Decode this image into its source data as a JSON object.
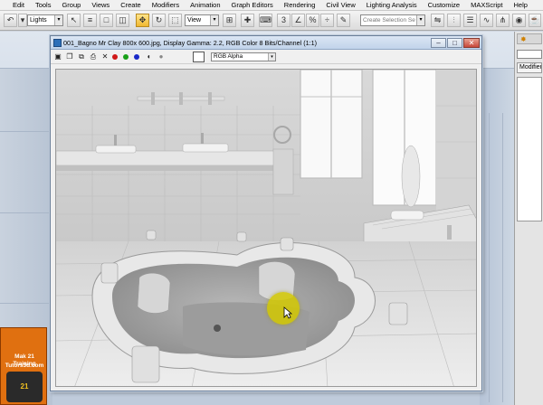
{
  "menu": [
    "Edit",
    "Tools",
    "Group",
    "Views",
    "Create",
    "Modifiers",
    "Animation",
    "Graph Editors",
    "Rendering",
    "Civil View",
    "Lighting Analysis",
    "Customize",
    "MAXScript",
    "Help"
  ],
  "toolbar": {
    "filter_value": "Lights",
    "refcoord_value": "View",
    "selection_set_placeholder": "Create Selection Se"
  },
  "render_window": {
    "title": "001_Bagno Mr Clay 800x 600.jpg, Display Gamma: 2.2, RGB Color 8 Bits/Channel (1:1)",
    "channel_value": "RGB Alpha",
    "channel_colors": [
      "#d01818",
      "#18a018",
      "#1828c8"
    ],
    "minimize_glyph": "–",
    "maximize_glyph": "□",
    "close_glyph": "✕"
  },
  "command_panel": {
    "list_header": "Modifier"
  },
  "logo": {
    "line1": "Mak 21 Training",
    "line2": "Tutors3d.com",
    "badge": "21"
  },
  "colors": {
    "accent": "#f0b830",
    "cursor_highlight": "#d2c800",
    "logo": "#e07010"
  }
}
